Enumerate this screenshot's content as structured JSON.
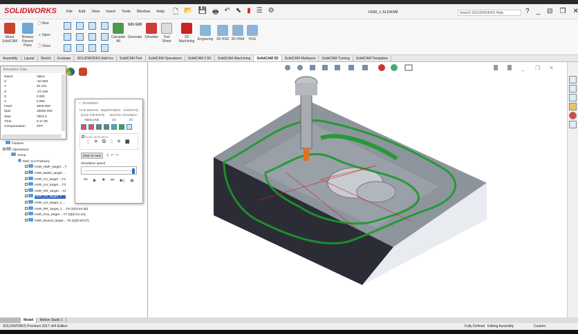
{
  "app": {
    "logo": "SOLIDWORKS",
    "doc_title": "HSM_1.SLDASM",
    "search_placeholder": "Search SOLIDWORKS Help"
  },
  "menu": [
    "File",
    "Edit",
    "View",
    "Insert",
    "Tools",
    "Window",
    "Help"
  ],
  "ribbon": {
    "about": "About SolidCAM",
    "browse": "Browse Recent Parts",
    "new": "New",
    "open": "Open",
    "close": "Close",
    "calc": "Calculate All",
    "gcode": "G01 G00",
    "generate": "Generate",
    "simulate": "Simulate",
    "toolsheet": "Tool Sheet",
    "machining3d": "3D Machining",
    "engraving": "Engraving",
    "hsr3d": "3D HSR",
    "hsm3d": "3D HSM",
    "hss": "HSS"
  },
  "tabs": [
    "Assembly",
    "Layout",
    "Sketch",
    "Evaluate",
    "SOLIDWORKS Add-Ins",
    "SolidCAM Part",
    "SolidCAM Operations",
    "SolidCAM 2.5D",
    "SolidCAM iMachining",
    "SolidCAM 3D",
    "SolidCAM Multiaxes",
    "SolidCAM Turning",
    "SolidCAM Templates"
  ],
  "active_tab": "SolidCAM 3D",
  "sim_data": {
    "title": "Simulation Data",
    "col_name": "Name",
    "col_value": "Value",
    "rows": [
      [
        "X",
        "-62.558"
      ],
      [
        "Y",
        "32.151"
      ],
      [
        "Z",
        "-27.245"
      ],
      [
        "C",
        "0.000"
      ],
      [
        "A",
        "0.000"
      ],
      [
        "Feed",
        "3000.000"
      ],
      [
        "Spin",
        "18000.000"
      ],
      [
        "Step",
        "7503.4"
      ],
      [
        "Time",
        "0:17:36"
      ],
      [
        "Compensation",
        "OFF"
      ]
    ]
  },
  "simulation": {
    "title": "Simulation",
    "tabs_row1": [
      "Host Material",
      "RapidVerify3X",
      "SolidVerify"
    ],
    "tabs_row2": [
      "Quick SolidVerify",
      "Machine Simulation"
    ],
    "tabs_row3": [
      "Host CAD",
      "3D",
      "2D"
    ],
    "solid_verification": "Solid verification",
    "stop_at_next": "Stop on next",
    "speed_label": "Simulation speed",
    "speed": 0.95
  },
  "tree": {
    "fixtures": "Fixtures",
    "operations": "Operations",
    "setup": "Setup",
    "mac": "MaC 1(1-Position)",
    "ops": [
      "HSR_HMF_target ...T",
      "HSR_Bashi_target ...",
      "HSR_C2_target ...T3",
      "HSR_Lin_target ...T3",
      "HSR_RR_target ...T4",
      "HSR_C2_target_1 ...",
      "HSR_Lin_target_1 ...",
      "HSR_RR_target_1 ...T6 (0)(0:04:30)",
      "HSR_Pen_target ...T7 (0)(0:21:44)",
      "HSR_Bound_target ...T8 (0)(0:50:27)"
    ],
    "selected_index": 5
  },
  "bottom_tabs": [
    "Model",
    "Motion Study 1"
  ],
  "status": {
    "edition": "SOLIDWORKS Premium 2017 x64 Edition",
    "defined": "Fully Defined",
    "editing": "Editing Assembly",
    "units": "Custom"
  }
}
